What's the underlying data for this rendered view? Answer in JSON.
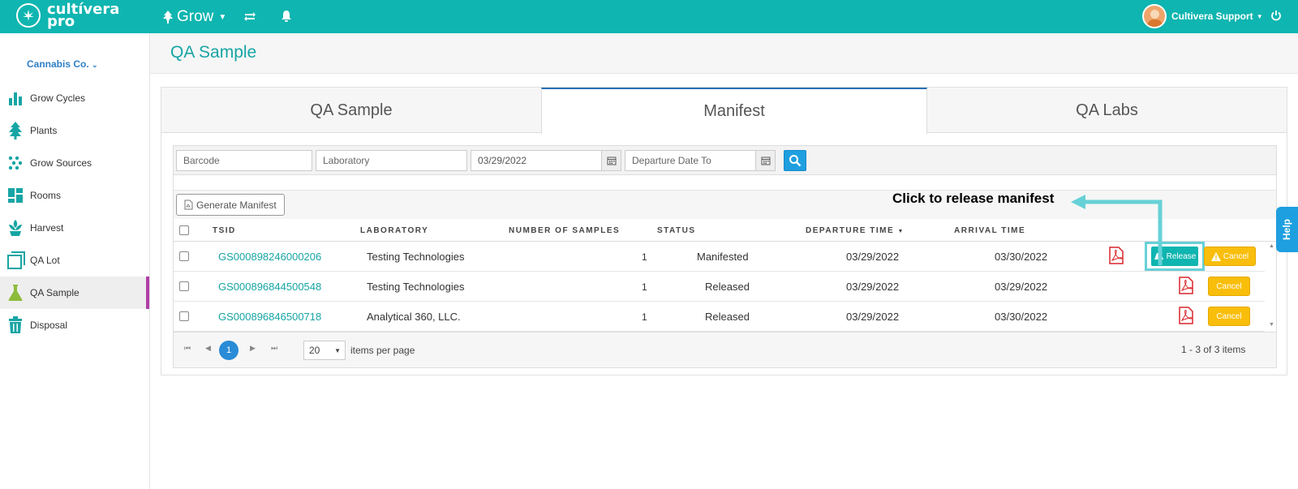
{
  "brand": {
    "line1": "cultívera",
    "line2": "pro"
  },
  "topbar": {
    "module": "Grow",
    "user": "Cultivera Support"
  },
  "sidebar": {
    "company": "Cannabis Co.",
    "items": [
      {
        "label": "Grow Cycles",
        "icon": "bar-chart-icon"
      },
      {
        "label": "Plants",
        "icon": "tree-icon"
      },
      {
        "label": "Grow Sources",
        "icon": "seeds-icon"
      },
      {
        "label": "Rooms",
        "icon": "rooms-grid-icon"
      },
      {
        "label": "Harvest",
        "icon": "harvest-icon"
      },
      {
        "label": "QA Lot",
        "icon": "stack-icon"
      },
      {
        "label": "QA Sample",
        "icon": "flask-icon"
      },
      {
        "label": "Disposal",
        "icon": "trash-icon"
      }
    ]
  },
  "page": {
    "title": "QA Sample"
  },
  "tabs": [
    "QA Sample",
    "Manifest",
    "QA Labs"
  ],
  "filters": {
    "barcode_placeholder": "Barcode",
    "laboratory_placeholder": "Laboratory",
    "departure_from": "03/29/2022",
    "departure_to_placeholder": "Departure Date To"
  },
  "toolbar": {
    "generate_label": "Generate Manifest"
  },
  "annotation": "Click to release manifest",
  "table": {
    "headers": [
      "TSID",
      "LABORATORY",
      "NUMBER OF SAMPLES",
      "STATUS",
      "DEPARTURE TIME",
      "ARRIVAL TIME"
    ],
    "rows": [
      {
        "tsid": "GS000898246000206",
        "lab": "Testing Technologies",
        "samples": "1",
        "status": "Manifested",
        "departure": "03/29/2022",
        "arrival": "03/30/2022"
      },
      {
        "tsid": "GS000896844500548",
        "lab": "Testing Technologies",
        "samples": "1",
        "status": "Released",
        "departure": "03/29/2022",
        "arrival": "03/29/2022"
      },
      {
        "tsid": "GS000896846500718",
        "lab": "Analytical 360, LLC.",
        "samples": "1",
        "status": "Released",
        "departure": "03/29/2022",
        "arrival": "03/30/2022"
      }
    ]
  },
  "actions": {
    "release": "Release",
    "cancel": "Cancel"
  },
  "pager": {
    "current": "1",
    "page_size": "20",
    "per_page_label": "items per page",
    "summary": "1 - 3 of 3 items"
  },
  "help": "Help",
  "colors": {
    "brand": "#0fb5b0",
    "accent": "#17a5a4",
    "warning": "#f9be0b",
    "link": "#2f80c8",
    "active_marker": "#b13ea8"
  }
}
